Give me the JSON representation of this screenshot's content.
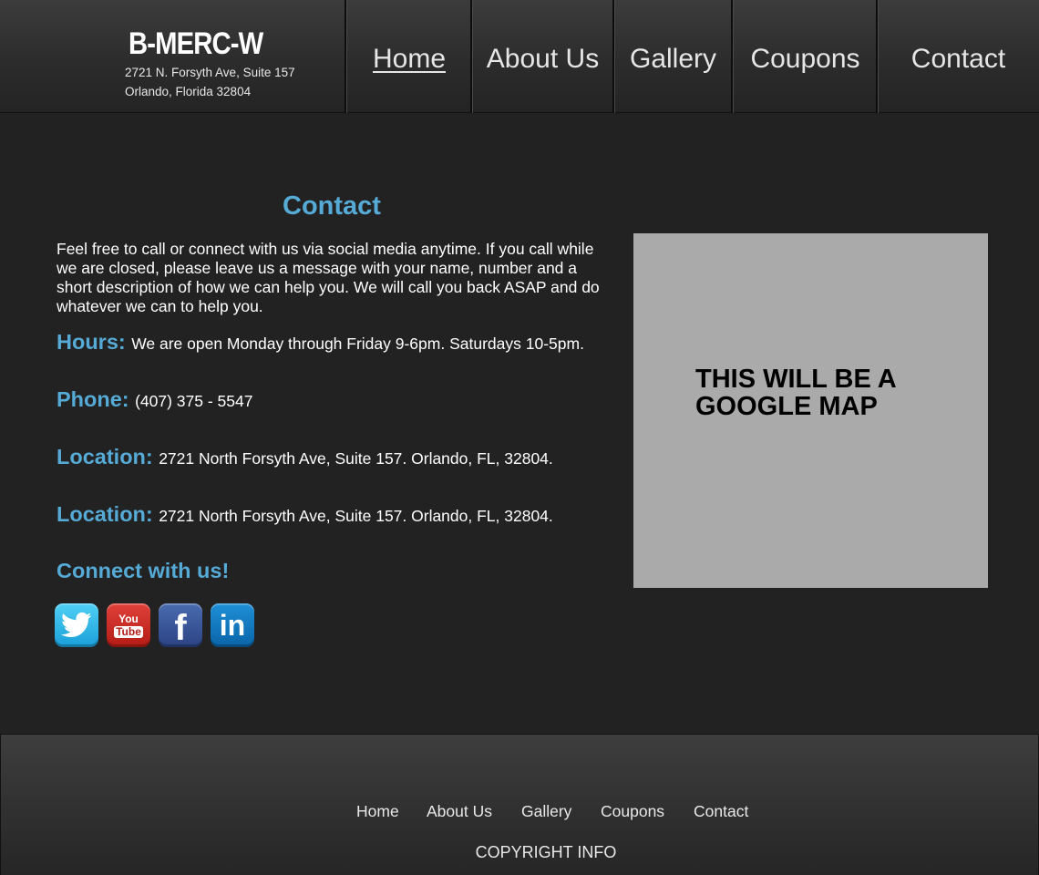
{
  "header": {
    "brand": "B-MERC-W",
    "address_line1": "2721 N. Forsyth Ave, Suite 157",
    "address_line2": "Orlando, Florida 32804",
    "nav": [
      {
        "label": "Home",
        "active": true
      },
      {
        "label": "About Us",
        "active": false
      },
      {
        "label": "Gallery",
        "active": false
      },
      {
        "label": "Coupons",
        "active": false
      },
      {
        "label": "Contact",
        "active": false
      }
    ]
  },
  "main": {
    "heading": "Contact",
    "intro": "Feel free to call or connect with us via social media anytime. If you call while we are closed, please leave us a message with your name, number and a short description of how we can help you. We will call you back ASAP and do whatever we can to help you.",
    "info": [
      {
        "label": "Hours:",
        "text": "We are open Monday through Friday 9-6pm. Saturdays 10-5pm."
      },
      {
        "label": "Phone:",
        "text": "(407) 375 - 5547"
      },
      {
        "label": "Location:",
        "text": "2721 North Forsyth Ave, Suite 157. Orlando, FL, 32804."
      },
      {
        "label": "Location:",
        "text": "2721 North Forsyth Ave, Suite 157. Orlando, FL, 32804."
      }
    ],
    "connect_heading": "Connect with us!",
    "social": {
      "icons": [
        "twitter-icon",
        "youtube-icon",
        "facebook-icon",
        "linkedin-icon"
      ],
      "youtube_you": "You",
      "youtube_tube": "Tube",
      "facebook_glyph": "f",
      "linkedin_glyph": "in"
    },
    "map_placeholder": "THIS WILL BE A GOOGLE MAP"
  },
  "footer": {
    "nav": [
      "Home",
      "About Us",
      "Gallery",
      "Coupons",
      "Contact"
    ],
    "copyright": "COPYRIGHT INFO"
  },
  "colors": {
    "background": "#222222",
    "accent": "#55aad6",
    "map_placeholder": "#aaaaaa"
  }
}
